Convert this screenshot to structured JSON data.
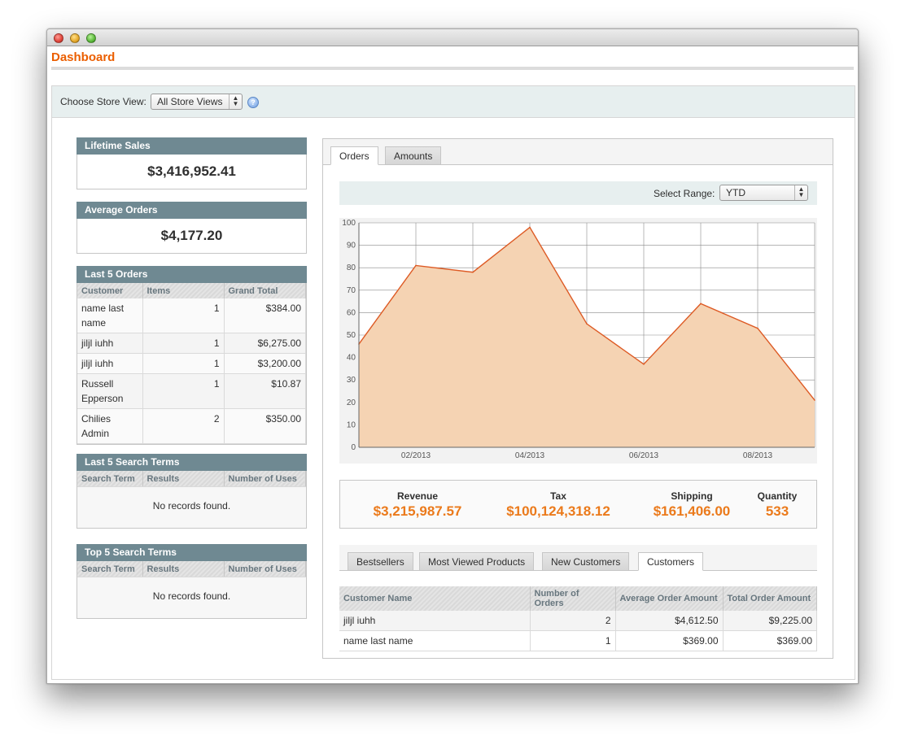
{
  "page": {
    "title": "Dashboard"
  },
  "store": {
    "label": "Choose Store View:",
    "selected": "All Store Views",
    "help": "?"
  },
  "lifetime_sales": {
    "title": "Lifetime Sales",
    "value": "$3,416,952.41"
  },
  "average_orders": {
    "title": "Average Orders",
    "value": "$4,177.20"
  },
  "last_orders": {
    "title": "Last 5 Orders",
    "columns": [
      "Customer",
      "Items",
      "Grand Total"
    ],
    "rows": [
      {
        "customer": "name last name",
        "items": "1",
        "total": "$384.00"
      },
      {
        "customer": "jiljl iuhh",
        "items": "1",
        "total": "$6,275.00"
      },
      {
        "customer": "jiljl iuhh",
        "items": "1",
        "total": "$3,200.00"
      },
      {
        "customer": "Russell Epperson",
        "items": "1",
        "total": "$10.87"
      },
      {
        "customer": "Chilies Admin",
        "items": "2",
        "total": "$350.00"
      }
    ]
  },
  "last_search": {
    "title": "Last 5 Search Terms",
    "columns": [
      "Search Term",
      "Results",
      "Number of Uses"
    ],
    "empty": "No records found."
  },
  "top_search": {
    "title": "Top 5 Search Terms",
    "columns": [
      "Search Term",
      "Results",
      "Number of Uses"
    ],
    "empty": "No records found."
  },
  "chart_tabs": [
    "Orders",
    "Amounts"
  ],
  "range": {
    "label": "Select Range:",
    "selected": "YTD"
  },
  "chart_data": {
    "type": "area",
    "x": [
      "01/2013",
      "02/2013",
      "03/2013",
      "04/2013",
      "05/2013",
      "06/2013",
      "07/2013",
      "08/2013",
      "09/2013"
    ],
    "x_tick_labels": [
      "02/2013",
      "04/2013",
      "06/2013",
      "08/2013"
    ],
    "values": [
      46,
      81,
      78,
      98,
      55,
      37,
      64,
      53,
      21
    ],
    "ylim": [
      0,
      100
    ],
    "y_ticks": [
      0,
      10,
      20,
      30,
      40,
      50,
      60,
      70,
      80,
      90,
      100
    ],
    "grid": true,
    "fill_color": "#f5d3b3",
    "line_color": "#dd5a24"
  },
  "totals": {
    "revenue": {
      "label": "Revenue",
      "value": "$3,215,987.57"
    },
    "tax": {
      "label": "Tax",
      "value": "$100,124,318.12"
    },
    "shipping": {
      "label": "Shipping",
      "value": "$161,406.00"
    },
    "quantity": {
      "label": "Quantity",
      "value": "533"
    }
  },
  "grid_tabs": [
    "Bestsellers",
    "Most Viewed Products",
    "New Customers",
    "Customers"
  ],
  "customers": {
    "columns": [
      "Customer Name",
      "Number of Orders",
      "Average Order Amount",
      "Total Order Amount"
    ],
    "rows": [
      {
        "name": "jiljl iuhh",
        "orders": "2",
        "avg": "$4,612.50",
        "total": "$9,225.00"
      },
      {
        "name": "name last name",
        "orders": "1",
        "avg": "$369.00",
        "total": "$369.00"
      }
    ]
  },
  "colors": {
    "accent": "#eb5e00",
    "header_bg": "#6f8992",
    "value_orange": "#eb7a1b"
  }
}
